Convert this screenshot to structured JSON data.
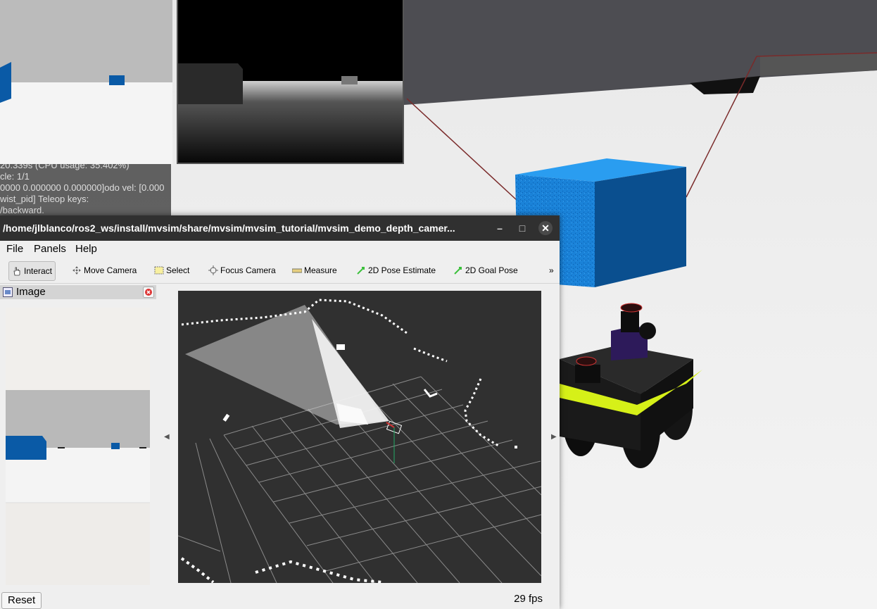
{
  "console": {
    "lines": [
      "20.339s (CPU usage: 35.402%)",
      "cle: 1/1",
      "0000 0.000000 0.000000]odo vel: [0.000",
      "wist_pid] Teleop keys:",
      "/backward."
    ]
  },
  "rviz": {
    "window_title": "/home/jlblanco/ros2_ws/install/mvsim/share/mvsim/mvsim_tutorial/mvsim_demo_depth_camer...",
    "window_controls": {
      "minimize": "–",
      "maximize": "□",
      "close": "✕"
    },
    "menu": {
      "file": "File",
      "panels": "Panels",
      "help": "Help"
    },
    "toolbar": {
      "interact": "Interact",
      "move_camera": "Move Camera",
      "select": "Select",
      "focus_camera": "Focus Camera",
      "measure": "Measure",
      "pose_estimate": "2D Pose Estimate",
      "goal_pose": "2D Goal Pose",
      "more": "»"
    },
    "image_panel": {
      "title": "Image"
    },
    "status": {
      "reset": "Reset",
      "fps": "29 fps"
    }
  },
  "colors": {
    "box_blue": "#0a7fd6",
    "robot_accent": "#d6f018",
    "titlebar": "#303030",
    "viewport_bg": "#303030"
  },
  "icons": [
    "hand-icon",
    "move-camera-icon",
    "select-icon",
    "focus-camera-icon",
    "measure-icon",
    "pose-arrow-icon",
    "goal-arrow-icon",
    "image-panel-icon",
    "close-icon"
  ]
}
